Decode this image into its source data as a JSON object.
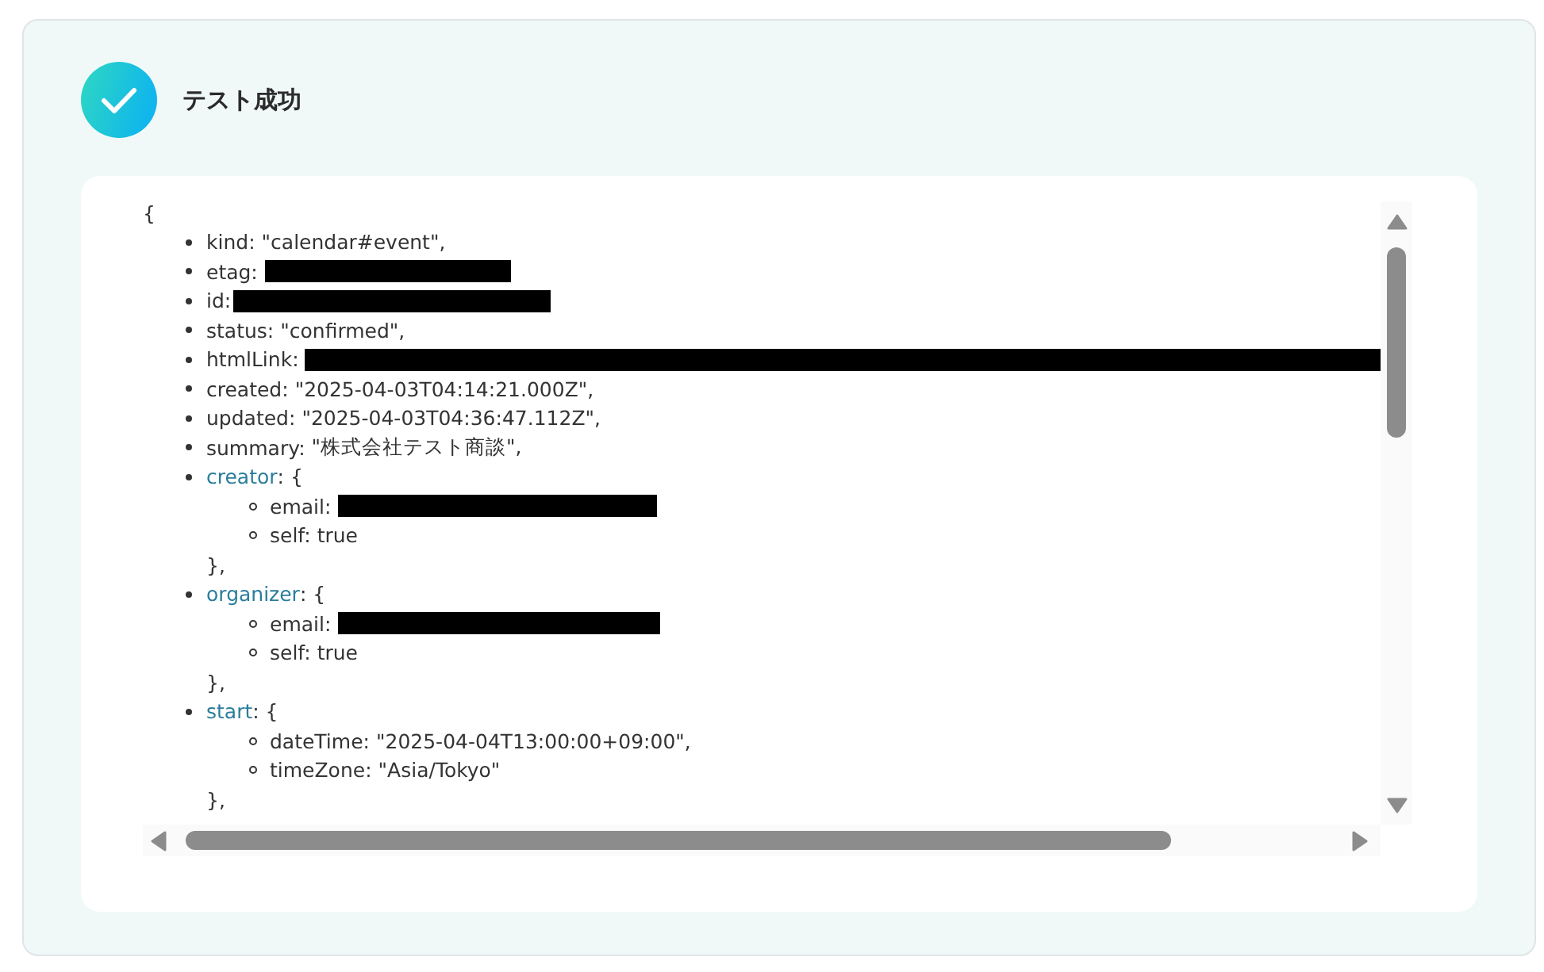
{
  "result": {
    "success": true,
    "title": "テスト成功"
  },
  "output": {
    "open": "{",
    "fields": [
      {
        "kind": "value",
        "key": "kind:",
        "value": "\"calendar#event\","
      },
      {
        "kind": "redacted",
        "key": "etag:"
      },
      {
        "kind": "redacted",
        "key": "id:"
      },
      {
        "kind": "value",
        "key": "status:",
        "value": "\"confirmed\","
      },
      {
        "kind": "redacted",
        "key": "htmlLink:"
      },
      {
        "kind": "value",
        "key": "created:",
        "value": "\"2025-04-03T04:14:21.000Z\","
      },
      {
        "kind": "value",
        "key": "updated:",
        "value": "\"2025-04-03T04:36:47.112Z\","
      },
      {
        "kind": "value",
        "key": "summary:",
        "value": "\"株式会社テスト商談\","
      },
      {
        "kind": "object",
        "key": "creator",
        "open": ": {",
        "close": "},",
        "children": [
          {
            "kind": "redacted",
            "key": "email:"
          },
          {
            "kind": "value",
            "key": "self:",
            "value": "true"
          }
        ]
      },
      {
        "kind": "object",
        "key": "organizer",
        "open": ": {",
        "close": "},",
        "children": [
          {
            "kind": "redacted",
            "key": "email:"
          },
          {
            "kind": "value",
            "key": "self:",
            "value": "true"
          }
        ]
      },
      {
        "kind": "object",
        "key": "start",
        "open": ": {",
        "close": "},",
        "children": [
          {
            "kind": "value",
            "key": "dateTime:",
            "value": "\"2025-04-04T13:00:00+09:00\","
          },
          {
            "kind": "value",
            "key": "timeZone:",
            "value": "\"Asia/Tokyo\""
          }
        ]
      }
    ]
  }
}
